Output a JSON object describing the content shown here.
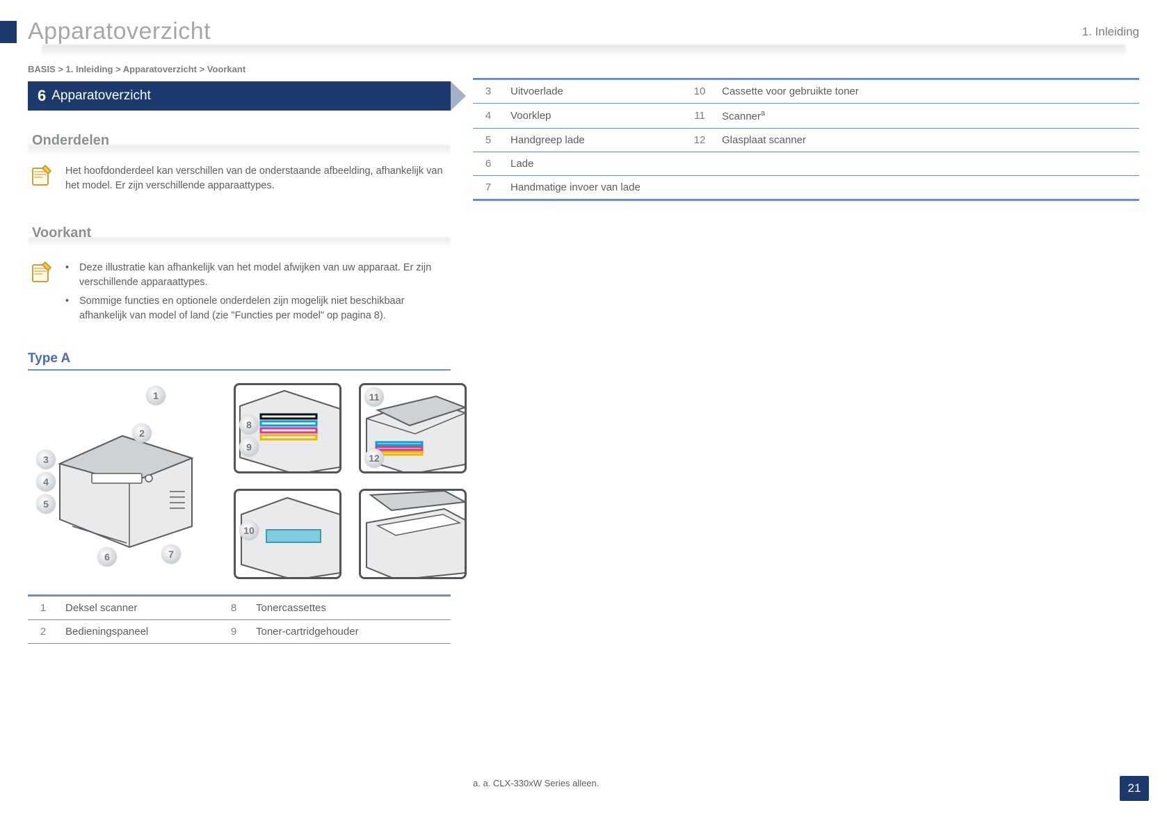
{
  "header": {
    "title": "Apparatoverzicht",
    "chapter_label": "1. Inleiding",
    "chapter_num": "1"
  },
  "breadcrumb": "BASIS > 1. Inleiding > Apparatoverzicht > Voorkant",
  "section_banner": {
    "num": "6",
    "label": "Apparatoverzicht"
  },
  "components_heading": "Onderdelen",
  "note": {
    "text": "Het hoofdonderdeel kan verschillen van de onderstaande afbeelding, afhankelijk van het model. Er zijn verschillende apparaattypes."
  },
  "bulleted_sentence": "Het hoofdonderdeel kan verschillen van de onderstaande afbeelding, afhankelijk van het model. Er zijn verschillende apparaattypes.",
  "front_heading": "Voorkant",
  "front_intro": "Deze illustratie kan afhankelijk van het model afwijken van uw apparaat. Er zijn verschillende apparaattypes.",
  "front_note2": "Sommige functies en optionele onderdelen zijn mogelijk niet beschikbaar afhankelijk van model of land (zie \"Functies per model\" op pagina 8).",
  "type_a_heading": "Type A",
  "callouts": {
    "c1": "1",
    "c2": "2",
    "c3": "3",
    "c4": "4",
    "c5": "5",
    "c6": "6",
    "c7": "7",
    "c8": "8",
    "c9": "9",
    "c10": "10",
    "c11": "11",
    "c12": "12"
  },
  "table_left": [
    {
      "n": "1",
      "label": "Deksel scanner",
      "n2": "2",
      "label2": "Bedieningspaneel"
    }
  ],
  "table_rows": [
    {
      "n": "1",
      "label": "Deksel scanner"
    },
    {
      "n": "2",
      "label": "Bedieningspaneel"
    },
    {
      "n": "3",
      "label": "Uitvoerlade",
      "n2": "8",
      "label2": "Tonercassettes"
    },
    {
      "n": "4",
      "label": "Voorklep",
      "n2": "9",
      "label2": "Toner-cartridgehouder"
    },
    {
      "n": "5",
      "label": "Handgreep lade",
      "n2": "10",
      "label2": "Cassette voor gebruikte toner"
    },
    {
      "n": "6",
      "label": "Lade",
      "n2": "11",
      "label2": "Scanner"
    },
    {
      "n": "7",
      "label": "Handmatige invoer van lade",
      "n2": "12",
      "label2": "Glasplaat scanner"
    }
  ],
  "footnote": "a. CLX-330xW Series alleen.",
  "page_number": "21"
}
